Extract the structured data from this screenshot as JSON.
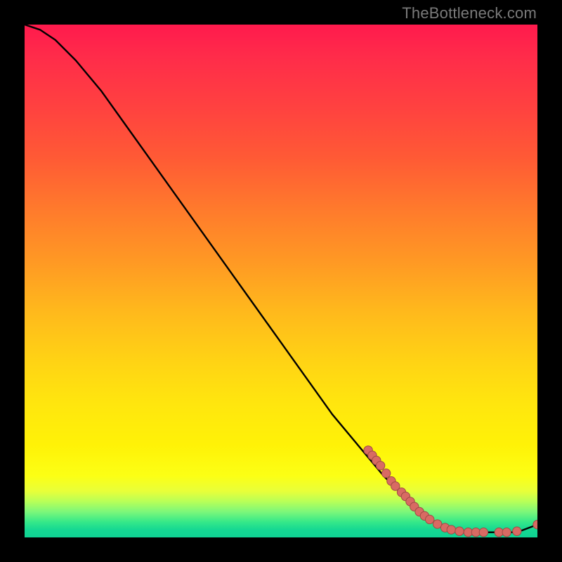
{
  "attribution": "TheBottleneck.com",
  "colors": {
    "background": "#000000",
    "curve": "#000000",
    "marker_fill": "#d86a63",
    "marker_stroke": "#9e4b45",
    "gradient_top": "#ff1a4d",
    "gradient_mid": "#ffe60e",
    "gradient_bottom": "#0fd293"
  },
  "chart_data": {
    "type": "line",
    "title": "",
    "xlabel": "",
    "ylabel": "",
    "xlim": [
      0,
      100
    ],
    "ylim": [
      0,
      100
    ],
    "grid": false,
    "legend": false,
    "series": [
      {
        "name": "bottleneck-curve",
        "x": [
          0,
          3,
          6,
          10,
          15,
          20,
          25,
          30,
          35,
          40,
          45,
          50,
          55,
          60,
          65,
          70,
          73,
          76,
          80,
          84,
          88,
          92,
          96,
          100
        ],
        "y": [
          100,
          99,
          97,
          93,
          87,
          80,
          73,
          66,
          59,
          52,
          45,
          38,
          31,
          24,
          18,
          12,
          9,
          6,
          3,
          1.5,
          1,
          1,
          1,
          2.5
        ]
      }
    ],
    "markers": [
      {
        "x": 67.0,
        "y": 17
      },
      {
        "x": 67.8,
        "y": 16
      },
      {
        "x": 68.6,
        "y": 15
      },
      {
        "x": 69.4,
        "y": 14
      },
      {
        "x": 70.5,
        "y": 12.5
      },
      {
        "x": 71.5,
        "y": 11
      },
      {
        "x": 72.3,
        "y": 10
      },
      {
        "x": 73.5,
        "y": 8.8
      },
      {
        "x": 74.3,
        "y": 8
      },
      {
        "x": 75.2,
        "y": 7
      },
      {
        "x": 76.0,
        "y": 6
      },
      {
        "x": 77.0,
        "y": 5
      },
      {
        "x": 78.0,
        "y": 4.2
      },
      {
        "x": 79.0,
        "y": 3.5
      },
      {
        "x": 80.5,
        "y": 2.6
      },
      {
        "x": 82.0,
        "y": 1.9
      },
      {
        "x": 83.2,
        "y": 1.5
      },
      {
        "x": 84.8,
        "y": 1.2
      },
      {
        "x": 86.5,
        "y": 1.0
      },
      {
        "x": 88.0,
        "y": 1.0
      },
      {
        "x": 89.5,
        "y": 1.0
      },
      {
        "x": 92.5,
        "y": 1.0
      },
      {
        "x": 94.0,
        "y": 1.0
      },
      {
        "x": 96.0,
        "y": 1.2
      },
      {
        "x": 100.0,
        "y": 2.5
      }
    ]
  }
}
